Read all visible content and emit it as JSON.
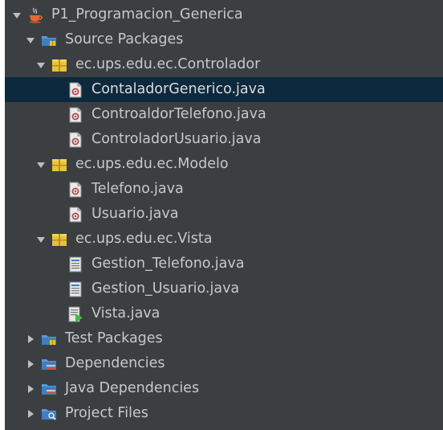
{
  "tree": {
    "project": {
      "label": "P1_Programacion_Generica",
      "icon": "java-project-icon",
      "expanded": true
    },
    "source_packages": {
      "label": "Source Packages",
      "icon": "source-packages-icon",
      "expanded": true
    },
    "packages": [
      {
        "label": "ec.ups.edu.ec.Controlador",
        "icon": "package-icon",
        "expanded": true,
        "files": [
          {
            "label": "ContaladorGenerico.java",
            "icon": "java-class-icon",
            "selected": true
          },
          {
            "label": "ControaldorTelefono.java",
            "icon": "java-class-icon",
            "selected": false
          },
          {
            "label": "ControladorUsuario.java",
            "icon": "java-class-icon",
            "selected": false
          }
        ]
      },
      {
        "label": "ec.ups.edu.ec.Modelo",
        "icon": "package-icon",
        "expanded": true,
        "files": [
          {
            "label": "Telefono.java",
            "icon": "java-class-icon",
            "selected": false
          },
          {
            "label": "Usuario.java",
            "icon": "java-class-icon",
            "selected": false
          }
        ]
      },
      {
        "label": "ec.ups.edu.ec.Vista",
        "icon": "package-icon",
        "expanded": true,
        "files": [
          {
            "label": "Gestion_Telefono.java",
            "icon": "form-file-icon",
            "selected": false
          },
          {
            "label": "Gestion_Usuario.java",
            "icon": "form-file-icon",
            "selected": false
          },
          {
            "label": "Vista.java",
            "icon": "main-class-icon",
            "selected": false
          }
        ]
      }
    ],
    "other_nodes": [
      {
        "label": "Test Packages",
        "icon": "test-packages-icon",
        "expanded": false
      },
      {
        "label": "Dependencies",
        "icon": "dependencies-icon",
        "expanded": false
      },
      {
        "label": "Java Dependencies",
        "icon": "java-dependencies-icon",
        "expanded": false
      },
      {
        "label": "Project Files",
        "icon": "project-files-icon",
        "expanded": false
      }
    ]
  },
  "colors": {
    "panel_bg": "#3c3f41",
    "selection_bg": "#0d293e",
    "text": "#c8c8c8",
    "package_yellow": "#e8c23c"
  }
}
